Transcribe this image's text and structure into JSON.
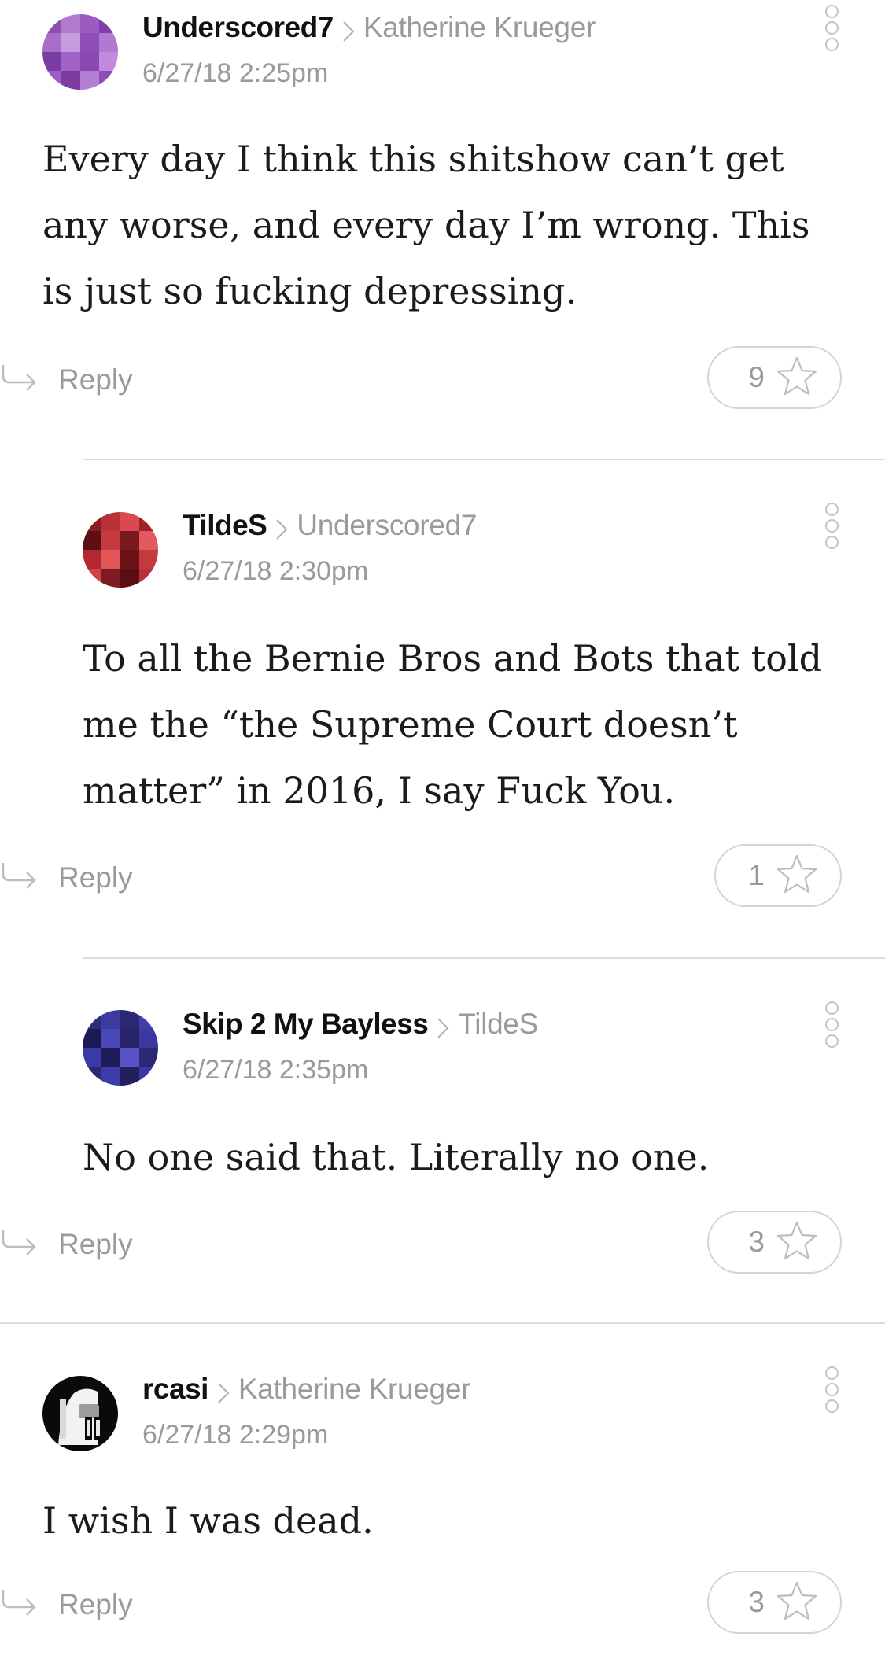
{
  "comments": [
    {
      "author": "Underscored7",
      "parent": "Katherine Krueger",
      "timestamp": "6/27/18 2:25pm",
      "text": "Every day I think this shitshow can’t get any worse, and every day I’m wrong. This is just so fucking depressing.",
      "reply_label": "Reply",
      "stars": "9",
      "avatar_colors": [
        "#8e4fb3",
        "#b27bd0",
        "#9a5cc0",
        "#7f3fa6",
        "#a86ccb",
        "#c79be0",
        "#8f4fb8",
        "#b07ad0",
        "#7b3ca2",
        "#a064c6",
        "#8a48b1",
        "#c08bdc",
        "#9c5ec4",
        "#7c3ca3",
        "#b47fd3",
        "#8d4db4"
      ]
    },
    {
      "author": "TildeS",
      "parent": "Underscored7",
      "timestamp": "6/27/18 2:30pm",
      "text": "To all the Bernie Bros and Bots that told me the “the Supreme Court doesn’t matter” in 2016, I say Fuck You.",
      "reply_label": "Reply",
      "stars": "1",
      "avatar_colors": [
        "#8a1c24",
        "#b83238",
        "#d84a4f",
        "#9f2028",
        "#5c1016",
        "#c33a40",
        "#7a1a20",
        "#e05a5e",
        "#b3282f",
        "#e05558",
        "#6a1218",
        "#c53a3f",
        "#d04348",
        "#7e1b22",
        "#5a0e14",
        "#b5303a"
      ]
    },
    {
      "author": "Skip 2 My Bayless",
      "parent": "TildeS",
      "timestamp": "6/27/18 2:35pm",
      "text": "No one said that.  Literally no one.",
      "reply_label": "Reply",
      "stars": "3",
      "avatar_colors": [
        "#2f2d75",
        "#3d3ba0",
        "#2a2870",
        "#403fa8",
        "#1c1a55",
        "#4a49b8",
        "#262466",
        "#3a38a0",
        "#3b39a6",
        "#1e1c58",
        "#5553c6",
        "#2b2974",
        "#2c2a6e",
        "#3e3ca8",
        "#211f5c",
        "#3a38a2"
      ]
    },
    {
      "author": "rcasi",
      "parent": "Katherine Krueger",
      "timestamp": "6/27/18 2:29pm",
      "text": "I wish I was dead.",
      "reply_label": "Reply",
      "stars": "3"
    }
  ]
}
